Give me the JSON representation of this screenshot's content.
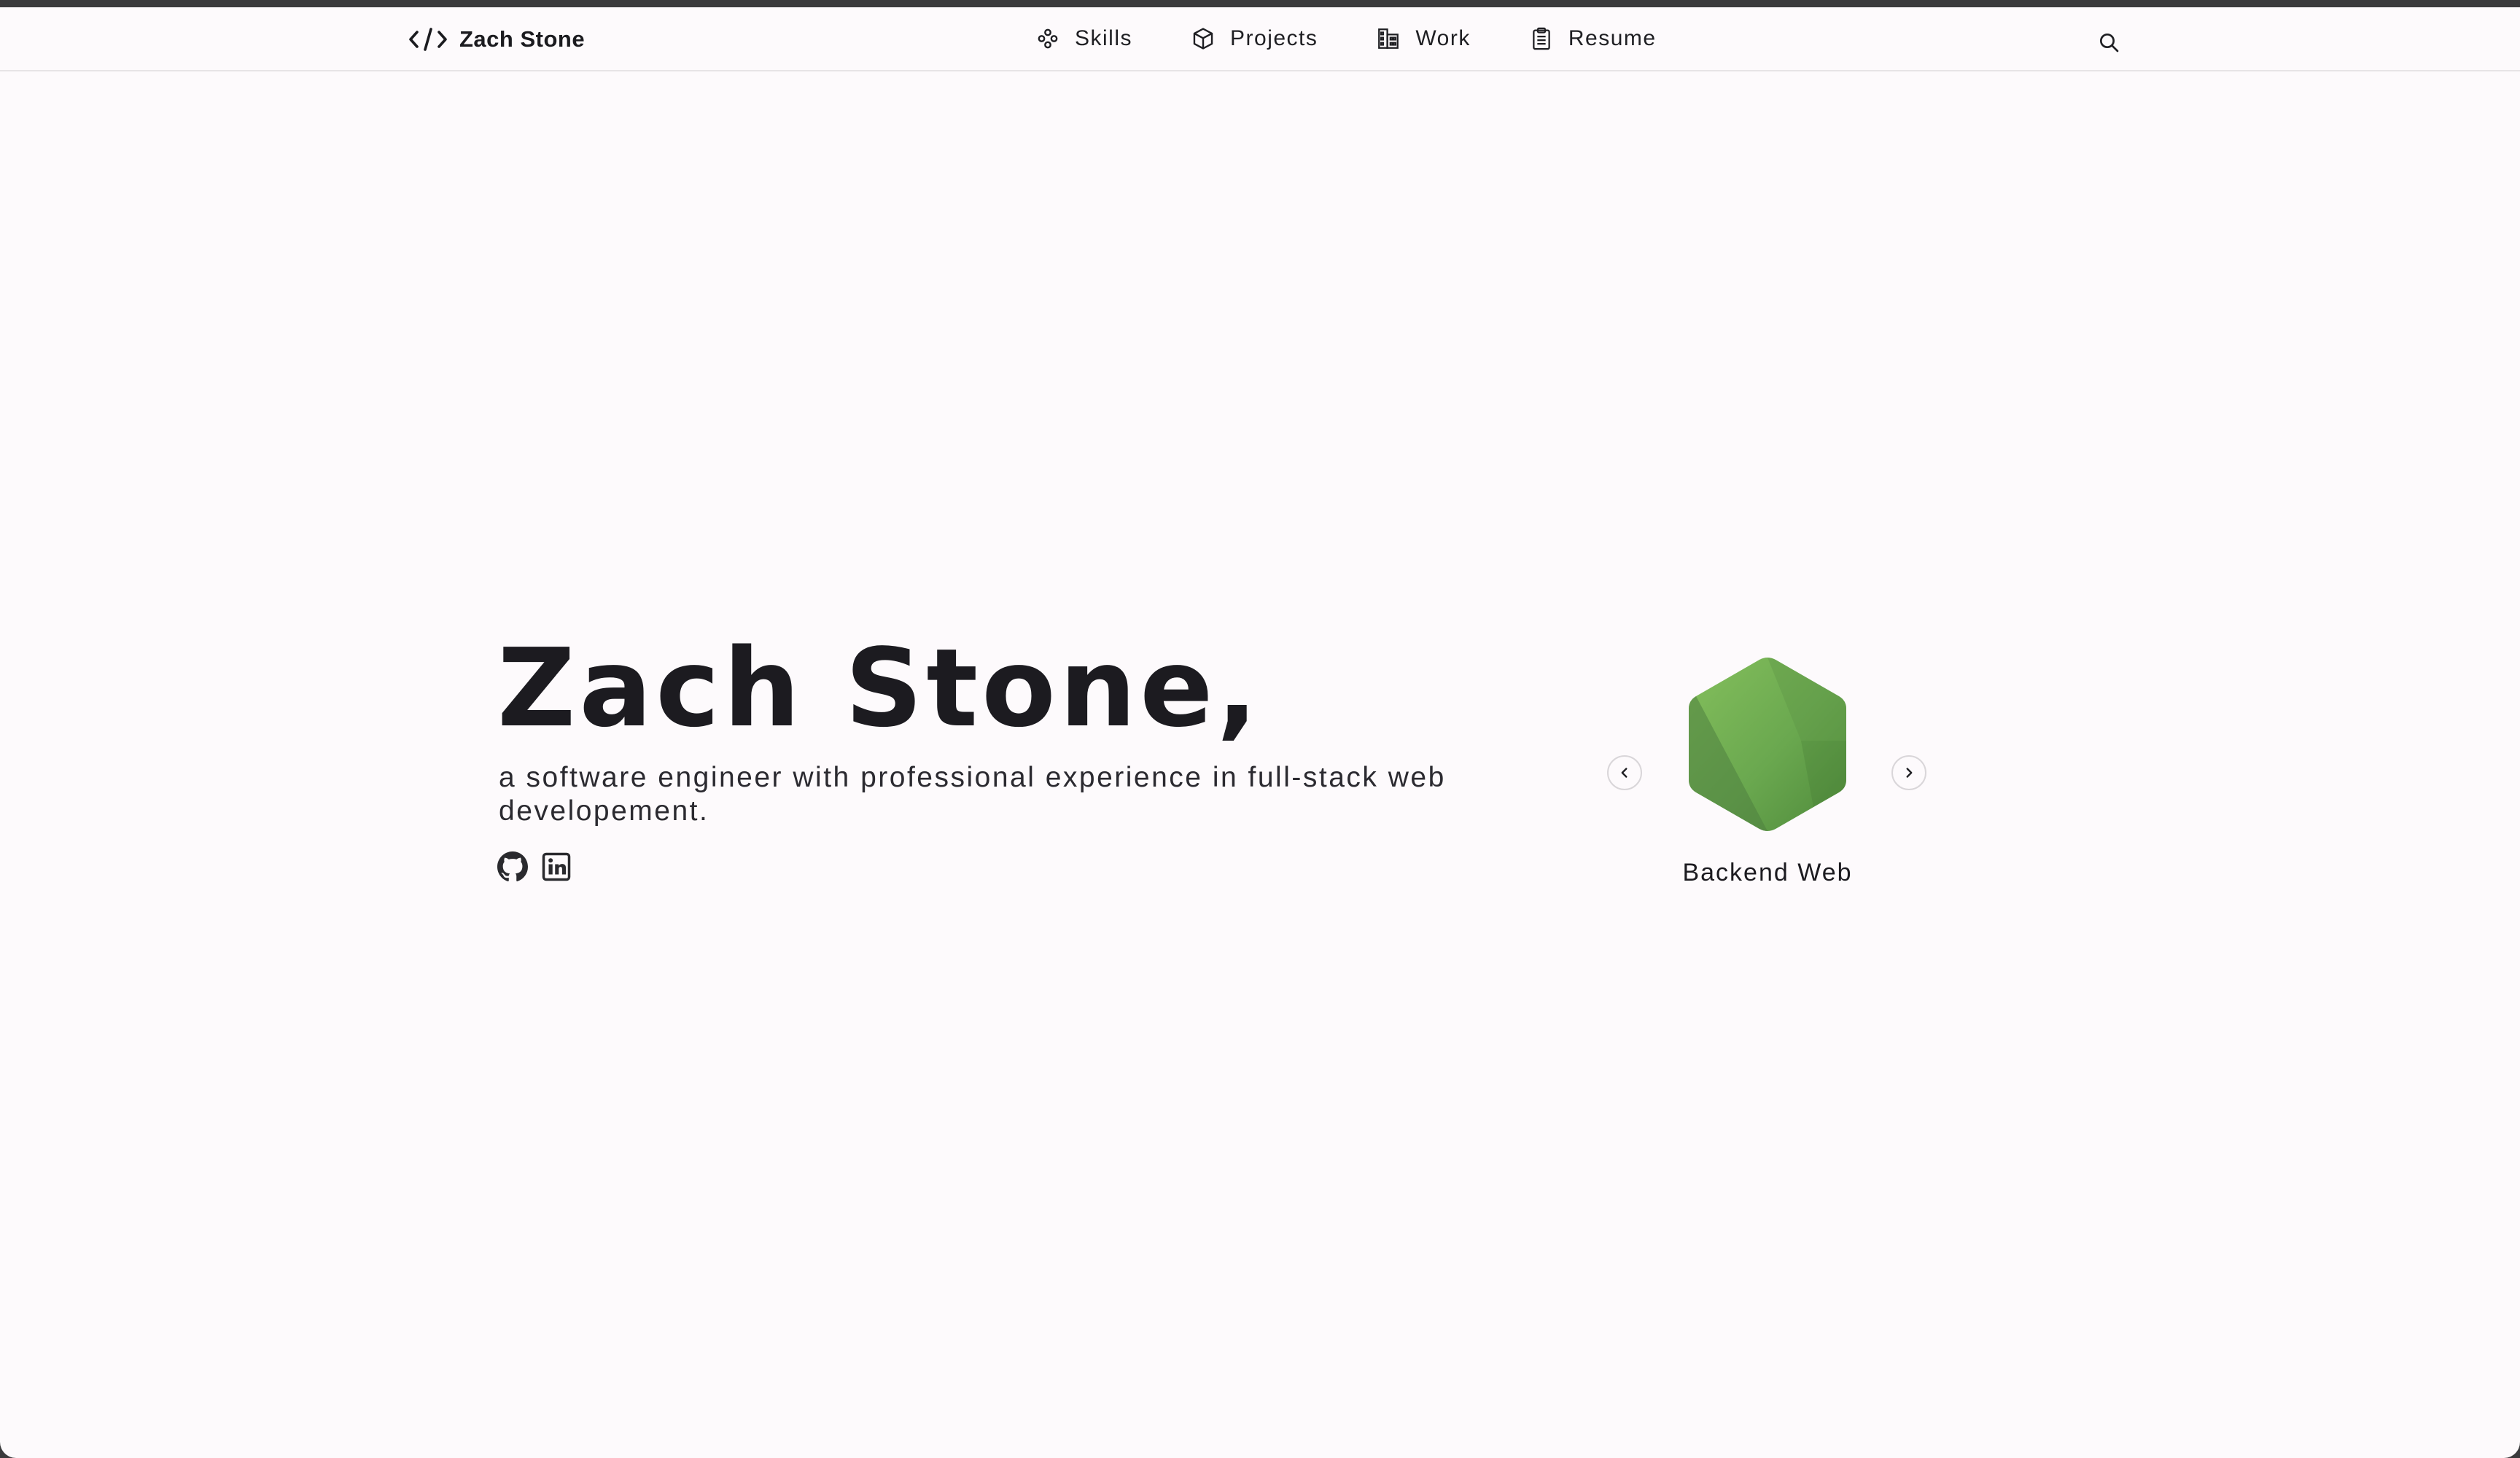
{
  "nav": {
    "brand": "Zach Stone",
    "links": [
      {
        "label": "Skills",
        "icon": "skills-icon"
      },
      {
        "label": "Projects",
        "icon": "cube-icon"
      },
      {
        "label": "Work",
        "icon": "building-icon"
      },
      {
        "label": "Resume",
        "icon": "clipboard-icon"
      }
    ],
    "search_icon": "search-icon"
  },
  "hero": {
    "title": "Zach Stone,",
    "subtitle": "a software engineer with professional experience in full-stack web developement.",
    "socials": [
      {
        "icon": "github-icon"
      },
      {
        "icon": "linkedin-icon"
      }
    ]
  },
  "carousel": {
    "current_label": "Backend Web",
    "logo_icon": "nodejs-hexagon-icon",
    "prev_icon": "chevron-left-icon",
    "next_icon": "chevron-right-icon"
  },
  "colors": {
    "background": "#fdfafc",
    "text": "#1c1b20",
    "node_green": "#6aa84f",
    "node_green_dark": "#4e8a3a",
    "frame": "#3a3a3c"
  }
}
